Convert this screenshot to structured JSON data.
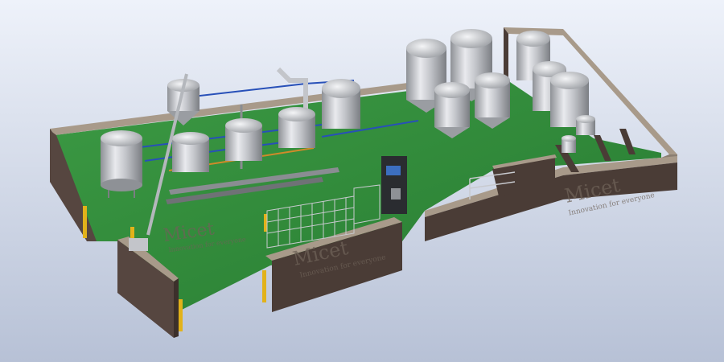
{
  "scene": {
    "background_top": "#eef2fa",
    "background_bottom": "#b7c1d6",
    "floor_color": "#2f8a3a",
    "wall_color": "#4a3c36",
    "wall_top_color": "#a89a8a",
    "tank_color": "#c9c9cc",
    "pipe_blue": "#2850b8",
    "pipe_orange": "#d08a2a"
  },
  "watermarks": [
    {
      "logo": "Micet",
      "tagline": "Innovation for everyone"
    },
    {
      "logo": "Micet",
      "tagline": "Innovation for everyone"
    },
    {
      "logo": "Micet",
      "tagline": "Innovation for everyone"
    }
  ]
}
